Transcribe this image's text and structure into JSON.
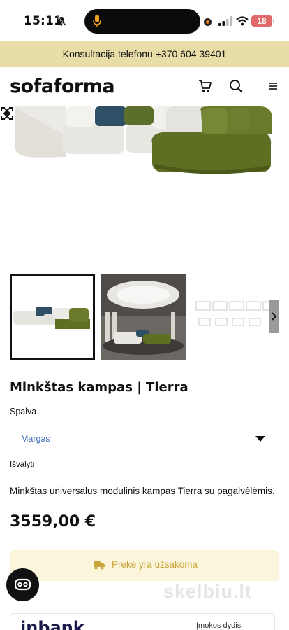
{
  "status_bar": {
    "time": "15:11",
    "battery": "18"
  },
  "announcement": {
    "text": "Konsultacija telefonu +370 604 39401"
  },
  "header": {
    "logo": "sofaforma",
    "icons": [
      "cart-icon",
      "search-icon",
      "menu-icon"
    ]
  },
  "gallery": {
    "icons": [
      "chevron-left-icon",
      "chevron-right-icon",
      "zoom-icon"
    ],
    "thumbnail_count": 3,
    "selected_thumbnail": 1
  },
  "product": {
    "title": "Minkštas kampas | Tierra",
    "color_label": "Spalva",
    "color_value": "Margas",
    "clear_label": "Išvalyti",
    "description": "Minkštas universalus modulinis kampas Tierra su pagalvėlėmis.",
    "price": "3559,00 €",
    "availability": "Prekė yra užsakoma"
  },
  "chat": {
    "icon": "chat-icon"
  },
  "watermark": "skelbiu.lt",
  "finance": {
    "logo": "inbank",
    "label": "Įmokos dydis"
  },
  "colors": {
    "announcement_bg": "#e8dca7",
    "availability_bg": "#fbf5dc",
    "availability_text": "#c8a53a",
    "select_text": "#4169b8"
  }
}
